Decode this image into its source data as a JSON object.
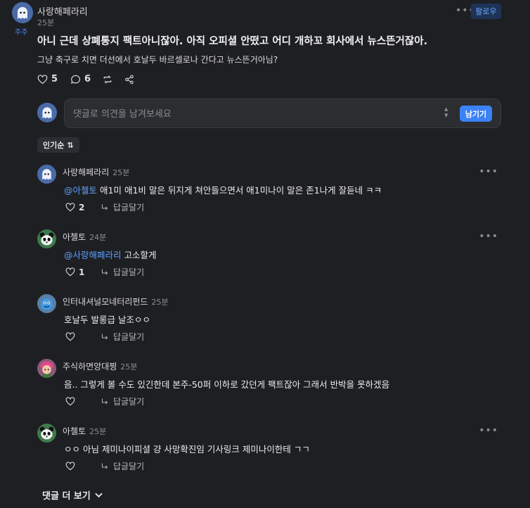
{
  "post": {
    "author": "사랑해페라리",
    "tag": "주주",
    "time": "25분",
    "follow_label": "팔로우",
    "title": "아니 근데 상폐통지 팩트아니잖아. 아직 오피셜 안떴고 어디 개하꼬 회사에서 뉴스뜬거잖아.",
    "body": "그냥 축구로 치면 더선에서 호날두 바르셀로나 간다고 뉴스뜬거아님?",
    "likes": "5",
    "comments": "6"
  },
  "composer": {
    "placeholder": "댓글로 의견을 남겨보세요",
    "submit_label": "남기기"
  },
  "sort": {
    "label": "인기순",
    "icon": "⇅"
  },
  "comment_list": [
    {
      "author": "사랑해페라리",
      "time": "25분",
      "mention": "@아첼토",
      "text": "애1미 애1비 말은 뒤지게 쳐안들으면서 애1미나이 말은 존1나게 잘듣네 ㅋㅋ",
      "likes": "2",
      "reply_label": "답글달기",
      "avatar": "ghost-avatar"
    },
    {
      "author": "아첼토",
      "time": "24분",
      "mention": "@사랑해페라리",
      "text": "고소할게",
      "likes": "1",
      "reply_label": "답글달기",
      "avatar": "panda-avatar"
    },
    {
      "author": "인터내셔널모네터리펀드",
      "time": "25분",
      "mention": "",
      "text": "호날두 발롱급 날조ㅇㅇ",
      "likes": "",
      "reply_label": "답글달기",
      "avatar": "blue-monster-avatar"
    },
    {
      "author": "주식하면앙대찡",
      "time": "25분",
      "mention": "",
      "text": "음.. 그렇게 볼 수도 있긴한데 본주-50퍼 이하로 갔던게 팩트잖아 그래서 반박을 못하겠음",
      "likes": "",
      "reply_label": "답글달기",
      "avatar": "pink-hair-avatar"
    },
    {
      "author": "아첼토",
      "time": "25분",
      "mention": "",
      "text": "ㅇㅇ 아님 제미나이피셜 걍 사망확진임 기사링크 제미나이한테 ㄱㄱ",
      "likes": "",
      "reply_label": "답글달기",
      "avatar": "panda-avatar"
    }
  ],
  "more_comments_label": "댓글 더 보기",
  "colors": {
    "background": "#1e1f22",
    "accent": "#3b82f6",
    "mention": "#5fa0ff"
  }
}
